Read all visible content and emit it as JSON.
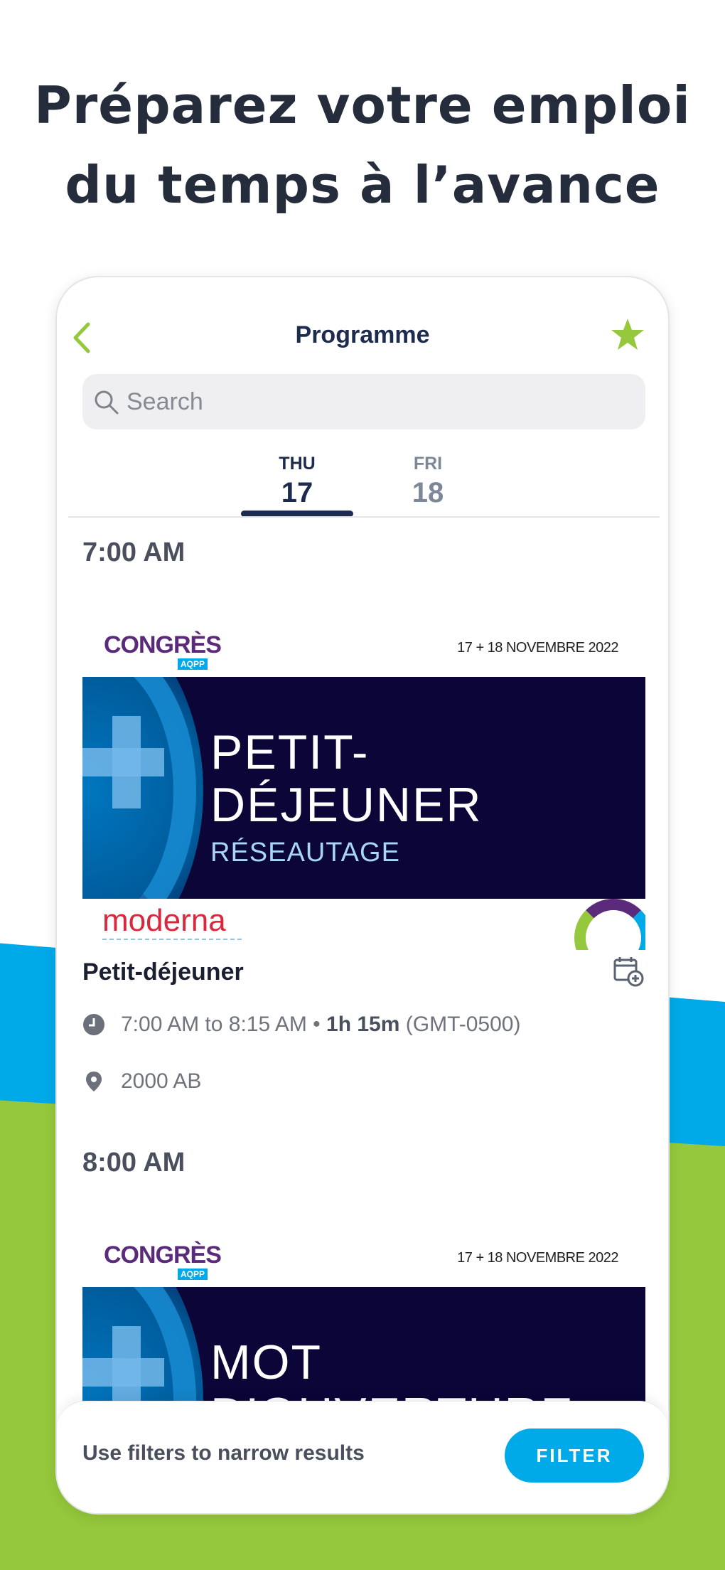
{
  "headline": {
    "line1": "Préparez votre emploi",
    "line2": "du temps à l’avance"
  },
  "colors": {
    "accent_green": "#95c83c",
    "accent_blue": "#00a9e8",
    "navy": "#1d2b4f"
  },
  "nav": {
    "title": "Programme",
    "back_icon": "chevron-left-icon",
    "favorite_icon": "star-icon"
  },
  "search": {
    "placeholder": "Search"
  },
  "days": [
    {
      "dow": "THU",
      "num": "17",
      "selected": true
    },
    {
      "dow": "FRI",
      "num": "18",
      "selected": false
    }
  ],
  "sessions": [
    {
      "time_header": "7:00 AM",
      "banner": {
        "brand": "CONGRÈS",
        "brand_sub": "AQPP",
        "dates": "17 + 18 NOVEMBRE 2022",
        "line1": "PETIT-",
        "line2": "DÉJEUNER",
        "line3": "RÉSEAUTAGE",
        "sponsor": "moderna"
      },
      "title": "Petit-déjeuner",
      "time_range": "7:00 AM to 8:15 AM •",
      "duration": "1h 15m",
      "timezone": "(GMT-0500)",
      "location": "2000 AB"
    },
    {
      "time_header": "8:00 AM",
      "banner": {
        "brand": "CONGRÈS",
        "brand_sub": "AQPP",
        "dates": "17 + 18 NOVEMBRE 2022",
        "line1": "MOT",
        "line2": "D’OUVERTURE"
      }
    }
  ],
  "bottom_bar": {
    "hint": "Use filters to narrow results",
    "filter_label": "FILTER"
  }
}
